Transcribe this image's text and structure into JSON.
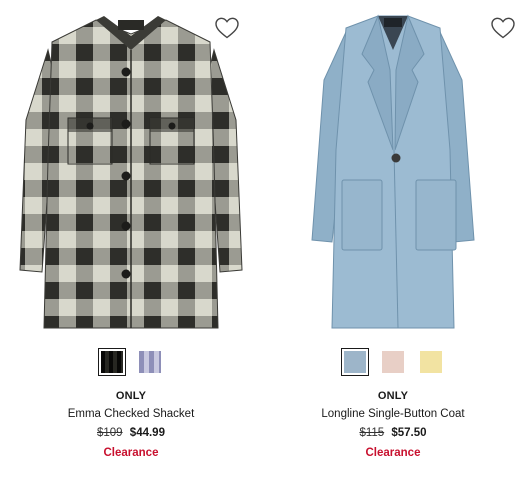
{
  "colors": {
    "clearance": "#c8102e",
    "text": "#1a1a1a"
  },
  "products": [
    {
      "brand": "ONLY",
      "name": "Emma Checked Shacket",
      "original_price": "$109",
      "sale_price": "$44.99",
      "badge": "Clearance",
      "wishlist_icon": "heart-outline-icon",
      "swatches": [
        {
          "color": "#3b3b36",
          "pattern": "check",
          "selected": true
        },
        {
          "color": "#8e8fb8",
          "pattern": "check",
          "selected": false
        }
      ]
    },
    {
      "brand": "ONLY",
      "name": "Longline Single-Button Coat",
      "original_price": "$115",
      "sale_price": "$57.50",
      "badge": "Clearance",
      "wishlist_icon": "heart-outline-icon",
      "swatches": [
        {
          "color": "#9db5c9",
          "pattern": "solid",
          "selected": true
        },
        {
          "color": "#e8cfc6",
          "pattern": "solid",
          "selected": false
        },
        {
          "color": "#f2e3a2",
          "pattern": "solid",
          "selected": false
        }
      ]
    }
  ]
}
